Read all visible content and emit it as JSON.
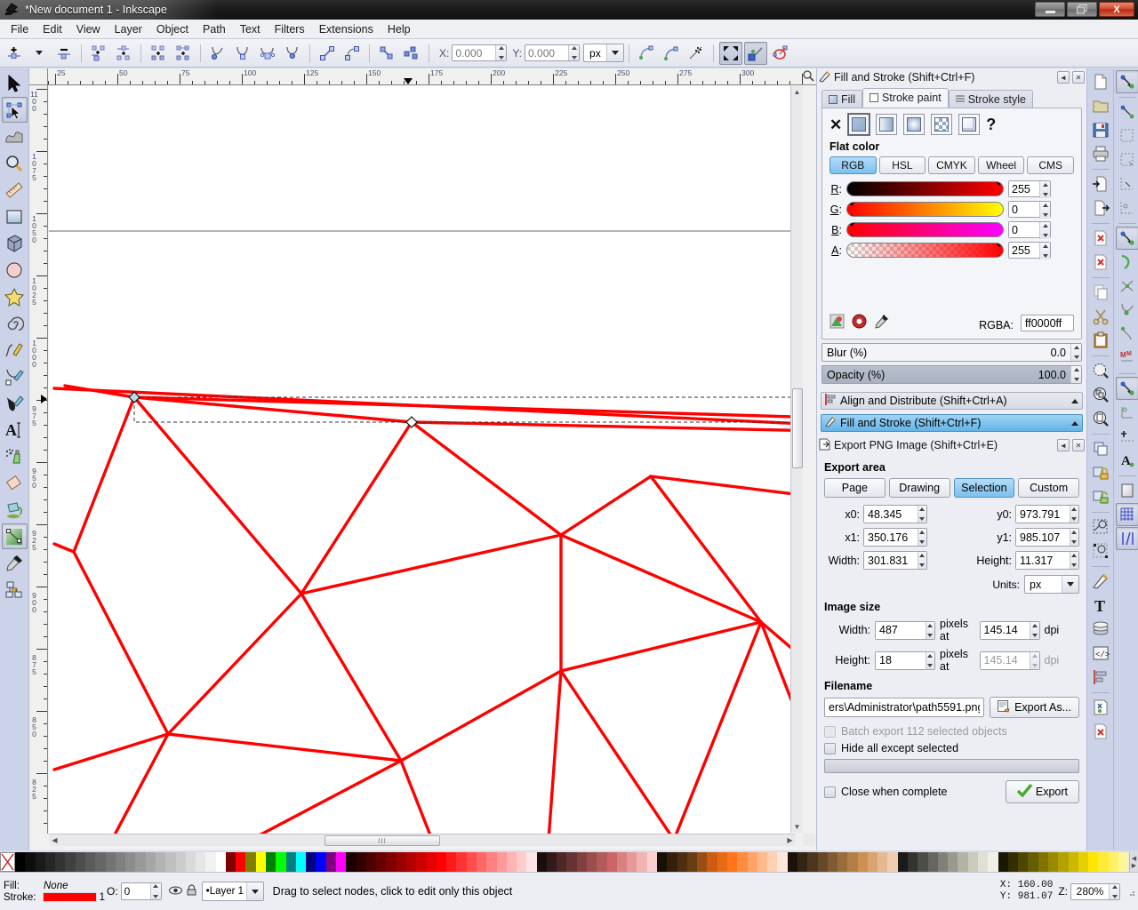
{
  "window": {
    "title": "*New document 1 - Inkscape",
    "minimize_label": "Minimize",
    "restore_label": "Restore",
    "close_label": "X"
  },
  "menu": [
    {
      "label": "File"
    },
    {
      "label": "Edit"
    },
    {
      "label": "View"
    },
    {
      "label": "Layer"
    },
    {
      "label": "Object"
    },
    {
      "label": "Path"
    },
    {
      "label": "Text"
    },
    {
      "label": "Filters"
    },
    {
      "label": "Extensions"
    },
    {
      "label": "Help"
    }
  ],
  "node_toolbar": {
    "x_label": "X:",
    "x_value": "0.000",
    "y_label": "Y:",
    "y_value": "0.000",
    "units": "px"
  },
  "rulers": {
    "horizontal_labels": [
      "25",
      "50",
      "75",
      "100",
      "125",
      "150",
      "175",
      "200",
      "225",
      "250",
      "275",
      "300"
    ],
    "vertical_labels": [
      "1100",
      "1075",
      "1050",
      "1025",
      "1000",
      "975",
      "950",
      "925",
      "900",
      "875",
      "850",
      "825"
    ]
  },
  "fill_stroke": {
    "title": "Fill and Stroke (Shift+Ctrl+F)",
    "tabs": [
      {
        "label": "Fill",
        "underline": "F"
      },
      {
        "label": "Stroke paint",
        "underline": "p"
      },
      {
        "label": "Stroke style",
        "underline": "y"
      }
    ],
    "active_tab": "Stroke paint",
    "paint_types": [
      "no-paint",
      "flat-color",
      "linear-gradient",
      "radial-gradient",
      "pattern",
      "swatch",
      "unknown"
    ],
    "flat_color_label": "Flat color",
    "color_modes": [
      "RGB",
      "HSL",
      "CMYK",
      "Wheel",
      "CMS"
    ],
    "active_color_mode": "RGB",
    "channels": [
      {
        "label": "R",
        "value": "255"
      },
      {
        "label": "G",
        "value": "0"
      },
      {
        "label": "B",
        "value": "0"
      },
      {
        "label": "A",
        "value": "255"
      }
    ],
    "rgba_label": "RGBA:",
    "rgba_value": "ff0000ff",
    "blur_label": "Blur (%)",
    "blur_value": "0.0",
    "opacity_label": "Opacity (%)",
    "opacity_value": "100.0"
  },
  "docks": [
    {
      "label": "Align and Distribute (Shift+Ctrl+A)",
      "selected": false
    },
    {
      "label": "Fill and Stroke (Shift+Ctrl+F)",
      "selected": true
    }
  ],
  "export_png": {
    "title": "Export PNG Image (Shift+Ctrl+E)",
    "export_area_label": "Export area",
    "area_buttons": [
      {
        "label": "Page",
        "underline": "P",
        "selected": false
      },
      {
        "label": "Drawing",
        "underline": "D",
        "selected": false
      },
      {
        "label": "Selection",
        "underline": "S",
        "selected": true
      },
      {
        "label": "Custom",
        "underline": "C",
        "selected": false
      }
    ],
    "x0_label": "x0:",
    "x0_value": "48.345",
    "y0_label": "y0:",
    "y0_value": "973.791",
    "x1_label": "x1:",
    "x1_value": "350.176",
    "y1_label": "y1:",
    "y1_value": "985.107",
    "width_label": "Width:",
    "width_value": "301.831",
    "height_label": "Height:",
    "height_value": "11.317",
    "units_label": "Units:",
    "units_value": "px",
    "image_size_label": "Image size",
    "img_width_label": "Width:",
    "img_width_value": "487",
    "img_height_label": "Height:",
    "img_height_value": "18",
    "pixels_at_label": "pixels at",
    "dpi_label": "dpi",
    "dpi_width_value": "145.14",
    "dpi_height_value": "145.14",
    "filename_label": "Filename",
    "filename_value": "ers\\Administrator\\path5591.png",
    "export_as_label": "Export As...",
    "batch_label": "Batch export 112 selected objects",
    "hide_all_label": "Hide all except selected",
    "close_when_complete_label": "Close when complete",
    "export_button_label": "Export"
  },
  "statusbar": {
    "fill_label": "Fill:",
    "fill_value": "None",
    "stroke_label": "Stroke:",
    "stroke_width": "1",
    "stroke_color": "#ff0000",
    "opacity_label": "O:",
    "opacity_value": "0",
    "layer_name": "Layer 1",
    "message": "Drag to select nodes, click to edit only this object",
    "x_label": "X:",
    "x_value": "160.00",
    "y_label": "Y:",
    "y_value": "981.07",
    "zoom_label": "Z:",
    "zoom_value": "280%"
  },
  "tools": [
    {
      "name": "selector-tool",
      "active": false
    },
    {
      "name": "node-tool",
      "active": true
    },
    {
      "name": "tweak-tool",
      "active": false
    },
    {
      "name": "zoom-tool",
      "active": false
    },
    {
      "name": "measure-tool",
      "active": false
    },
    {
      "name": "rectangle-tool",
      "active": false
    },
    {
      "name": "box3d-tool",
      "active": false
    },
    {
      "name": "ellipse-tool",
      "active": false
    },
    {
      "name": "star-tool",
      "active": false
    },
    {
      "name": "spiral-tool",
      "active": false
    },
    {
      "name": "pencil-tool",
      "active": false
    },
    {
      "name": "bezier-tool",
      "active": false
    },
    {
      "name": "calligraphy-tool",
      "active": false
    },
    {
      "name": "text-tool",
      "active": false
    },
    {
      "name": "spray-tool",
      "active": false
    },
    {
      "name": "eraser-tool",
      "active": false
    },
    {
      "name": "paintbucket-tool",
      "active": false
    },
    {
      "name": "gradient-tool",
      "active": true
    },
    {
      "name": "dropper-tool",
      "active": false
    },
    {
      "name": "connector-tool",
      "active": false
    }
  ],
  "canvas": {
    "stroke_color": "#ff0000",
    "background": "#ffffff",
    "selection_nodes": [
      [
        130,
        447
      ],
      [
        442,
        475
      ]
    ],
    "mesh_lines": [
      [
        [
          40,
          437
        ],
        [
          905,
          478
        ]
      ],
      [
        [
          52,
          434
        ],
        [
          130,
          447
        ]
      ],
      [
        [
          130,
          447
        ],
        [
          905,
          470
        ]
      ],
      [
        [
          130,
          447
        ],
        [
          442,
          475
        ]
      ],
      [
        [
          442,
          475
        ],
        [
          905,
          485
        ]
      ],
      [
        [
          130,
          447
        ],
        [
          62,
          621
        ]
      ],
      [
        [
          130,
          447
        ],
        [
          318,
          668
        ]
      ],
      [
        [
          442,
          475
        ],
        [
          318,
          668
        ]
      ],
      [
        [
          442,
          475
        ],
        [
          610,
          602
        ]
      ],
      [
        [
          610,
          602
        ],
        [
          711,
          536
        ]
      ],
      [
        [
          711,
          536
        ],
        [
          905,
          560
        ]
      ],
      [
        [
          711,
          536
        ],
        [
          835,
          700
        ]
      ],
      [
        [
          610,
          602
        ],
        [
          835,
          700
        ]
      ],
      [
        [
          318,
          668
        ],
        [
          610,
          602
        ]
      ],
      [
        [
          318,
          668
        ],
        [
          168,
          826
        ]
      ],
      [
        [
          62,
          621
        ],
        [
          168,
          826
        ]
      ],
      [
        [
          62,
          621
        ],
        [
          40,
          612
        ]
      ],
      [
        [
          168,
          826
        ],
        [
          430,
          856
        ]
      ],
      [
        [
          318,
          668
        ],
        [
          430,
          856
        ]
      ],
      [
        [
          430,
          856
        ],
        [
          610,
          755
        ]
      ],
      [
        [
          610,
          755
        ],
        [
          835,
          700
        ]
      ],
      [
        [
          610,
          755
        ],
        [
          430,
          856
        ]
      ],
      [
        [
          610,
          602
        ],
        [
          610,
          755
        ]
      ],
      [
        [
          430,
          856
        ],
        [
          261,
          945
        ]
      ],
      [
        [
          168,
          826
        ],
        [
          105,
          945
        ]
      ],
      [
        [
          168,
          826
        ],
        [
          40,
          866
        ]
      ],
      [
        [
          430,
          856
        ],
        [
          465,
          945
        ]
      ],
      [
        [
          610,
          755
        ],
        [
          737,
          945
        ]
      ],
      [
        [
          610,
          755
        ],
        [
          596,
          945
        ]
      ],
      [
        [
          835,
          700
        ],
        [
          905,
          760
        ]
      ],
      [
        [
          835,
          700
        ],
        [
          905,
          880
        ]
      ],
      [
        [
          737,
          945
        ],
        [
          835,
          700
        ]
      ]
    ]
  }
}
